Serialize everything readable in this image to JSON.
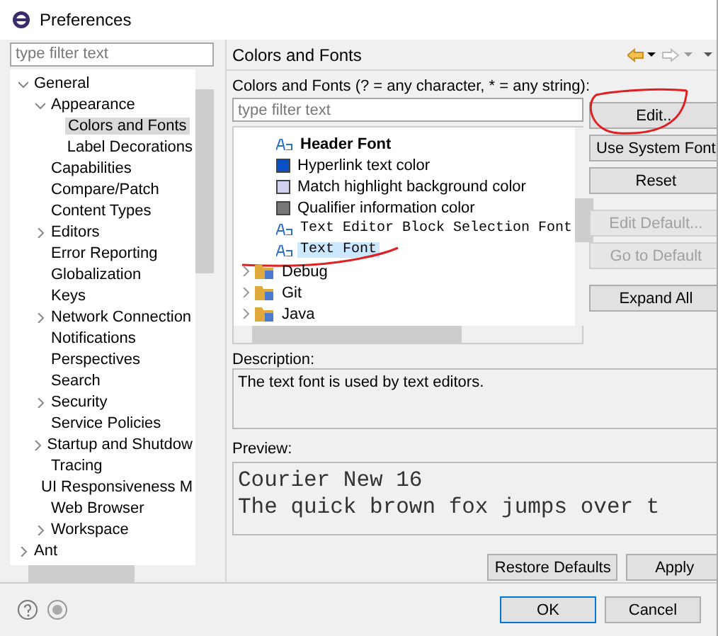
{
  "window": {
    "title": "Preferences"
  },
  "sidebar": {
    "filter": {
      "placeholder": "type filter text"
    },
    "tree": [
      {
        "label": "General",
        "kind": "folder",
        "expanded": true,
        "selected": false,
        "children": [
          {
            "label": "Appearance",
            "kind": "folder",
            "expanded": true,
            "selected": false,
            "children": [
              {
                "label": "Colors and Fonts",
                "kind": "leaf",
                "selected": true
              },
              {
                "label": "Label Decorations",
                "kind": "leaf",
                "selected": false
              }
            ]
          },
          {
            "label": "Capabilities",
            "kind": "leaf",
            "selected": false
          },
          {
            "label": "Compare/Patch",
            "kind": "leaf",
            "selected": false
          },
          {
            "label": "Content Types",
            "kind": "leaf",
            "selected": false
          },
          {
            "label": "Editors",
            "kind": "folder",
            "expanded": false,
            "selected": false
          },
          {
            "label": "Error Reporting",
            "kind": "leaf",
            "selected": false
          },
          {
            "label": "Globalization",
            "kind": "leaf",
            "selected": false
          },
          {
            "label": "Keys",
            "kind": "leaf",
            "selected": false
          },
          {
            "label": "Network Connection",
            "kind": "folder",
            "expanded": false,
            "selected": false
          },
          {
            "label": "Notifications",
            "kind": "leaf",
            "selected": false
          },
          {
            "label": "Perspectives",
            "kind": "leaf",
            "selected": false
          },
          {
            "label": "Search",
            "kind": "leaf",
            "selected": false
          },
          {
            "label": "Security",
            "kind": "folder",
            "expanded": false,
            "selected": false
          },
          {
            "label": "Service Policies",
            "kind": "leaf",
            "selected": false
          },
          {
            "label": "Startup and Shutdow",
            "kind": "folder",
            "expanded": false,
            "selected": false
          },
          {
            "label": "Tracing",
            "kind": "leaf",
            "selected": false
          },
          {
            "label": "UI Responsiveness M",
            "kind": "leaf",
            "selected": false
          },
          {
            "label": "Web Browser",
            "kind": "leaf",
            "selected": false
          },
          {
            "label": "Workspace",
            "kind": "folder",
            "expanded": false,
            "selected": false
          }
        ]
      },
      {
        "label": "Ant",
        "kind": "folder",
        "expanded": false,
        "selected": false
      }
    ]
  },
  "page": {
    "title": "Colors and Fonts",
    "filter_label": "Colors and Fonts (? = any character, * = any string):",
    "filter": {
      "placeholder": "type filter text"
    },
    "items": [
      {
        "label": "Header Font",
        "kind": "header",
        "selected": false
      },
      {
        "label": "Hyperlink text color",
        "kind": "color",
        "color": "#0a4fc4",
        "selected": false
      },
      {
        "label": "Match highlight background color",
        "kind": "color",
        "color": "#d4d0f0",
        "selected": false
      },
      {
        "label": "Qualifier information color",
        "kind": "color",
        "color": "#777777",
        "selected": false
      },
      {
        "label": "Text Editor Block Selection Font",
        "kind": "mono",
        "selected": false
      },
      {
        "label": "Text Font",
        "kind": "mono",
        "selected": true
      },
      {
        "label": "Debug",
        "kind": "category",
        "selected": false
      },
      {
        "label": "Git",
        "kind": "category",
        "selected": false
      },
      {
        "label": "Java",
        "kind": "category",
        "selected": false
      }
    ],
    "buttons": [
      {
        "label": "Edit...",
        "disabled": false
      },
      {
        "label": "Use System Font",
        "disabled": false
      },
      {
        "label": "Reset",
        "disabled": false
      },
      {
        "label": "Edit Default...",
        "disabled": true
      },
      {
        "label": "Go to Default",
        "disabled": true
      },
      {
        "label": "Expand All",
        "disabled": false
      }
    ],
    "description_label": "Description:",
    "description": "The text font is used by text editors.",
    "preview_label": "Preview:",
    "preview": [
      "Courier New 16",
      "The quick brown fox jumps over t"
    ],
    "actions": [
      "Restore Defaults",
      "Apply"
    ]
  },
  "dialog_buttons": [
    {
      "label": "OK",
      "default": true
    },
    {
      "label": "Cancel",
      "default": false
    }
  ],
  "annotations": [
    {
      "kind": "circle"
    },
    {
      "kind": "underline"
    }
  ]
}
